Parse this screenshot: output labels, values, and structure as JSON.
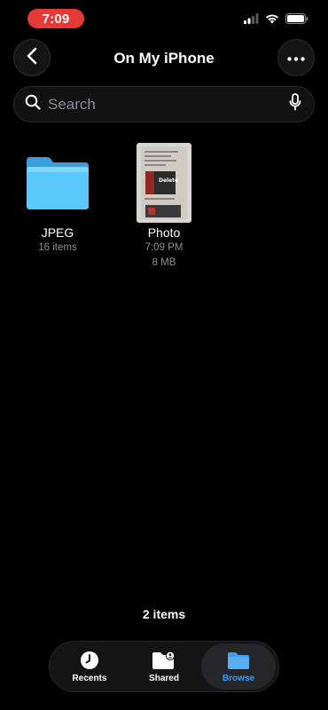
{
  "status_bar": {
    "time": "7:09"
  },
  "nav": {
    "title": "On My iPhone"
  },
  "search": {
    "placeholder": "Search"
  },
  "items": [
    {
      "name": "JPEG",
      "meta_line1": "16 items",
      "meta_line2": "",
      "icon": "folder-icon"
    },
    {
      "name": "Photo",
      "meta_line1": "7:09 PM",
      "meta_line2": "8 MB",
      "icon": "photo-thumbnail"
    }
  ],
  "photo_thumbnail_text": "Delete",
  "footer": {
    "count": "2 items"
  },
  "tabs": [
    {
      "label": "Recents",
      "icon": "clock-icon",
      "active": false
    },
    {
      "label": "Shared",
      "icon": "shared-folder-icon",
      "active": false
    },
    {
      "label": "Browse",
      "icon": "folder-icon",
      "active": true
    }
  ],
  "colors": {
    "accent": "#3d9cf2",
    "time_pill": "#e53935",
    "folder": "#5ac8fa",
    "secondary_text": "#8e8e93"
  }
}
